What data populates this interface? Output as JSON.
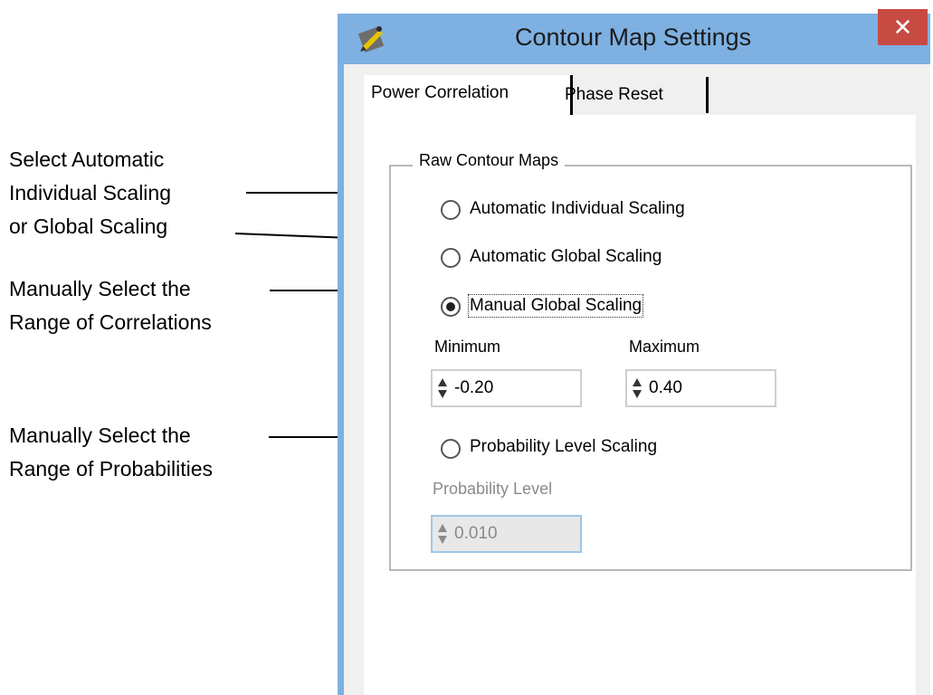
{
  "annotations": {
    "scaling": [
      "Select Automatic",
      "Individual Scaling",
      "or Global Scaling"
    ],
    "correlations": [
      "Manually Select the",
      "Range of Correlations"
    ],
    "probabilities": [
      "Manually Select the",
      "Range of Probabilities"
    ]
  },
  "window": {
    "title": "Contour Map Settings",
    "close_glyph": "✕"
  },
  "tabs": [
    {
      "label": "Power Correlation",
      "active": true
    },
    {
      "label": "Phase Reset",
      "active": false
    }
  ],
  "group": {
    "title": "Raw Contour Maps",
    "options": [
      {
        "label": "Automatic Individual Scaling",
        "checked": false
      },
      {
        "label": "Automatic Global Scaling",
        "checked": false
      },
      {
        "label": "Manual Global Scaling",
        "checked": true
      },
      {
        "label": "Probability Level Scaling",
        "checked": false
      }
    ],
    "minimum": {
      "label": "Minimum",
      "value": "-0.20"
    },
    "maximum": {
      "label": "Maximum",
      "value": "0.40"
    },
    "probability": {
      "label": "Probability Level",
      "value": "0.010",
      "enabled": false
    }
  },
  "colors": {
    "titlebar": "#7eb0e2",
    "close": "#c74b43"
  }
}
